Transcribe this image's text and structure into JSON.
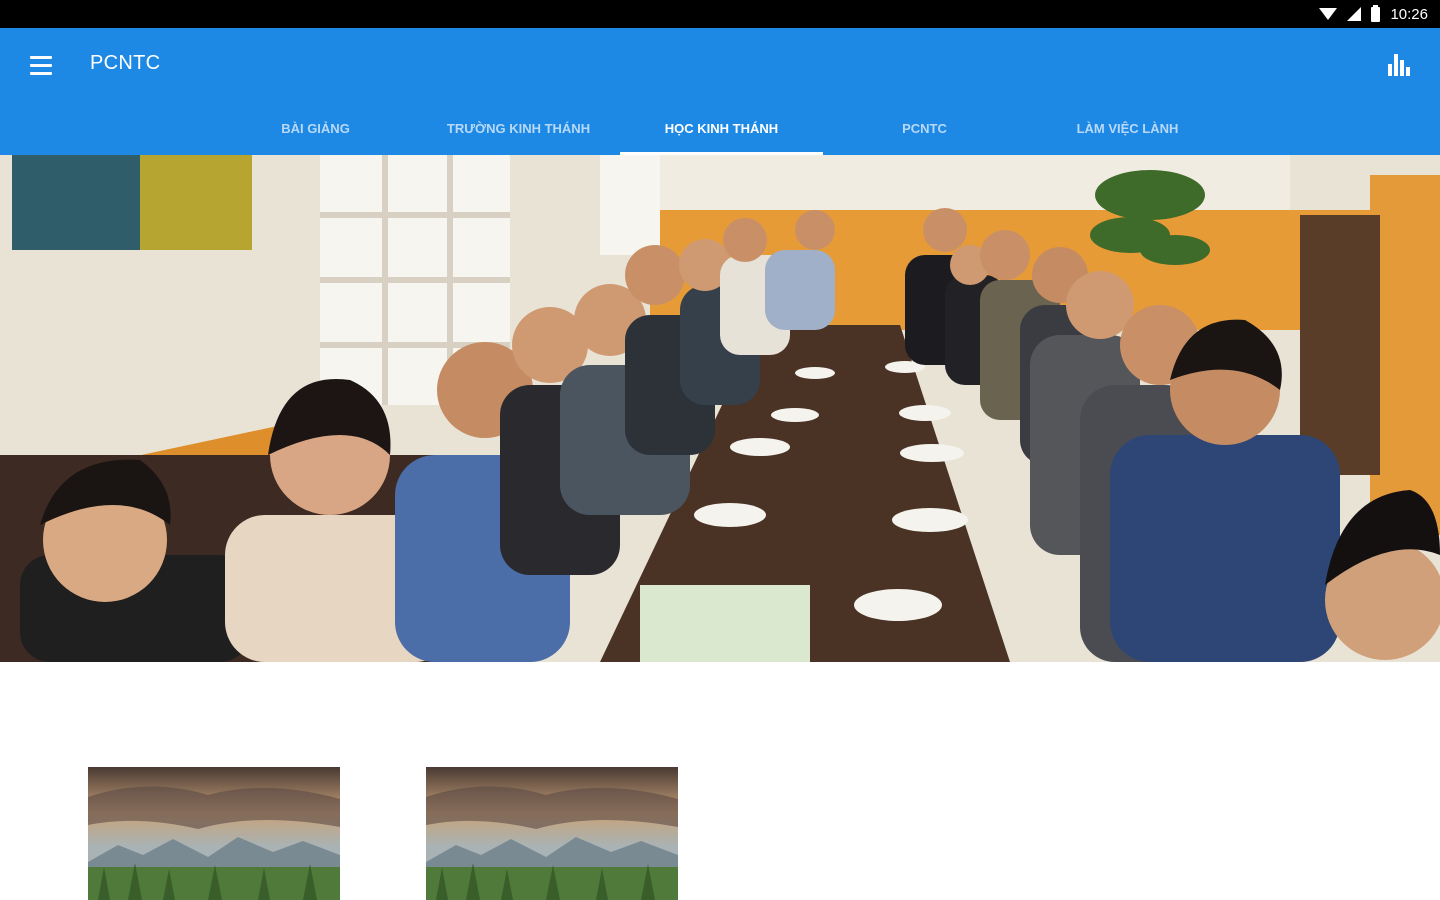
{
  "status_bar": {
    "time": "10:26"
  },
  "app_bar": {
    "title": "PCNTC",
    "background": "#1e88e5"
  },
  "tabs": [
    {
      "label": "BÀI GIẢNG",
      "active": false
    },
    {
      "label": "TRƯỜNG KINH THÁNH",
      "active": false
    },
    {
      "label": "HỌC KINH THÁNH",
      "active": true
    },
    {
      "label": "PCNTC",
      "active": false
    },
    {
      "label": "LÀM VIỆC LÀNH",
      "active": false
    }
  ],
  "icons": {
    "menu": "menu-icon",
    "chart": "bar-chart-icon",
    "wifi": "wifi-icon",
    "signal": "signal-icon",
    "battery": "battery-icon"
  },
  "colors": {
    "accent": "#1e88e5",
    "status_bar": "#000000"
  }
}
